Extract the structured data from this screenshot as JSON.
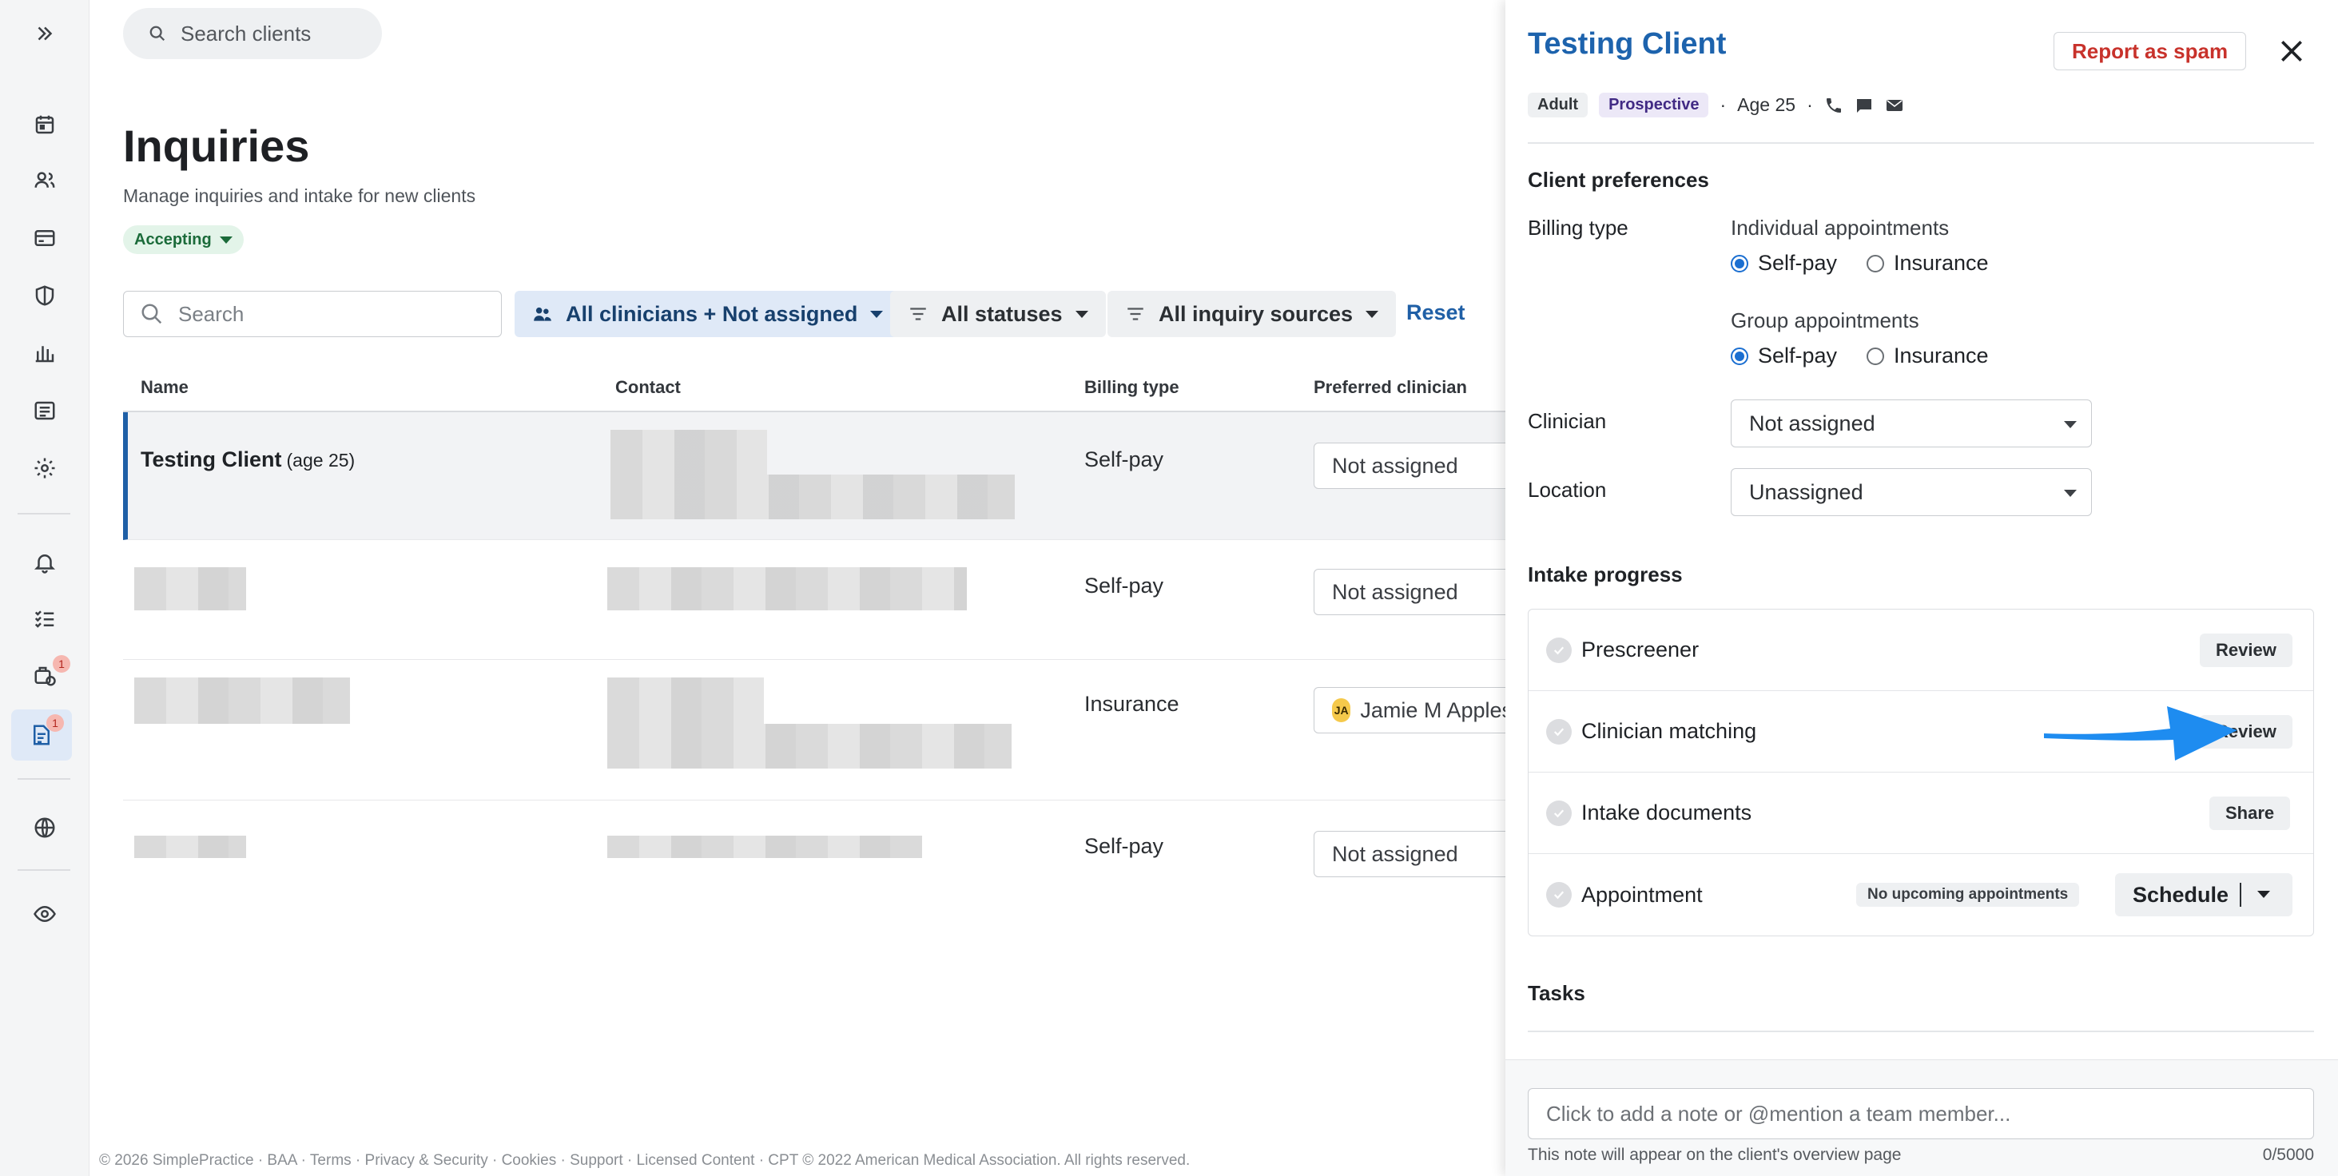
{
  "top_search": {
    "placeholder": "Search clients"
  },
  "page": {
    "title": "Inquiries",
    "subtitle": "Manage inquiries and intake for new clients",
    "status_pill": "Accepting"
  },
  "filters": {
    "search_placeholder": "Search",
    "clinicians": "All clinicians + Not assigned",
    "statuses": "All statuses",
    "sources": "All inquiry sources",
    "reset": "Reset"
  },
  "table": {
    "headers": {
      "name": "Name",
      "contact": "Contact",
      "billing": "Billing type",
      "clinician": "Preferred clinician"
    },
    "rows": [
      {
        "name": "Testing Client",
        "age": "(age 25)",
        "billing": "Self-pay",
        "clinician": "Not assigned"
      },
      {
        "name": "",
        "age": "",
        "billing": "Self-pay",
        "clinician": "Not assigned"
      },
      {
        "name": "",
        "age": "",
        "billing": "Insurance",
        "clinician": "Jamie M Apples",
        "initials": "JA"
      },
      {
        "name": "",
        "age": "",
        "billing": "Self-pay",
        "clinician": "Not assigned"
      }
    ]
  },
  "footer": "© 2026 SimplePractice · BAA · Terms · Privacy & Security · Cookies · Support · Licensed Content · CPT © 2022 American Medical Association. All rights reserved.",
  "rail": {
    "icons": [
      "expand-icon",
      "calendar-icon",
      "clients-icon",
      "billing-icon",
      "insurance-shield-icon",
      "analytics-icon",
      "documents-icon",
      "settings-icon",
      "bell-icon",
      "tasks-icon",
      "requests-icon",
      "inquiries-icon",
      "globe-icon",
      "eye-icon"
    ],
    "badges": {
      "requests": "1",
      "inquiries": "1"
    }
  },
  "panel": {
    "title": "Testing Client",
    "spam_button": "Report as spam",
    "meta": {
      "tag_adult": "Adult",
      "tag_status": "Prospective",
      "sep": "·",
      "age": "Age 25"
    },
    "preferences": {
      "title": "Client preferences",
      "billing_label": "Billing type",
      "individual_label": "Individual appointments",
      "group_label": "Group appointments",
      "self_pay": "Self-pay",
      "insurance": "Insurance",
      "clinician_label": "Clinician",
      "clinician_value": "Not assigned",
      "location_label": "Location",
      "location_value": "Unassigned"
    },
    "intake": {
      "title": "Intake progress",
      "steps": [
        {
          "label": "Prescreener",
          "action": "Review"
        },
        {
          "label": "Clinician matching",
          "action": "Review"
        },
        {
          "label": "Intake documents",
          "action": "Share"
        },
        {
          "label": "Appointment",
          "badge": "No upcoming appointments",
          "action": "Schedule"
        }
      ]
    },
    "tasks_title": "Tasks",
    "note": {
      "placeholder": "Click to add a note or @mention a team member...",
      "hint": "This note will appear on the client's overview page",
      "count": "0/5000"
    }
  },
  "colors": {
    "accent_blue": "#1d63ad",
    "spam_red": "#c8322b",
    "arrow_blue": "#1e8cf0",
    "accepting_green": "#1b6b3a"
  }
}
